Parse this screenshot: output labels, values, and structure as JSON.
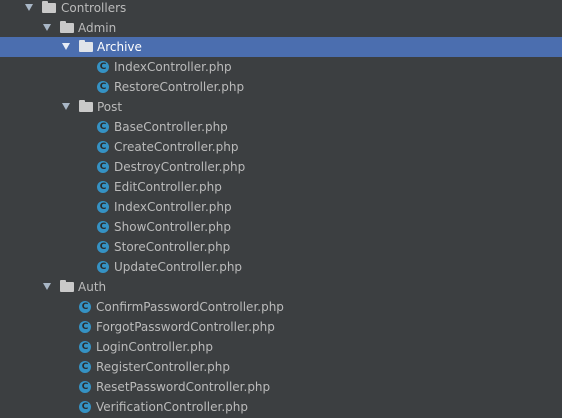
{
  "tree": {
    "controllers": {
      "label": "Controllers"
    },
    "admin": {
      "label": "Admin"
    },
    "archive": {
      "label": "Archive",
      "files": [
        {
          "label": "IndexController.php"
        },
        {
          "label": "RestoreController.php"
        }
      ]
    },
    "post": {
      "label": "Post",
      "files": [
        {
          "label": "BaseController.php"
        },
        {
          "label": "CreateController.php"
        },
        {
          "label": "DestroyController.php"
        },
        {
          "label": "EditController.php"
        },
        {
          "label": "IndexController.php"
        },
        {
          "label": "ShowController.php"
        },
        {
          "label": "StoreController.php"
        },
        {
          "label": "UpdateController.php"
        }
      ]
    },
    "auth": {
      "label": "Auth",
      "files": [
        {
          "label": "ConfirmPasswordController.php"
        },
        {
          "label": "ForgotPasswordController.php"
        },
        {
          "label": "LoginController.php"
        },
        {
          "label": "RegisterController.php"
        },
        {
          "label": "ResetPasswordController.php"
        },
        {
          "label": "VerificationController.php"
        }
      ]
    }
  },
  "icons": {
    "expanded": "expand-arrow-icon",
    "folder": "folder-icon",
    "file": "php-class-icon",
    "class_glyph": "C"
  },
  "colors": {
    "background": "#3c3f41",
    "selection": "#4b6eaf",
    "text": "#bbbbbb",
    "class_icon": "#3592c4"
  }
}
